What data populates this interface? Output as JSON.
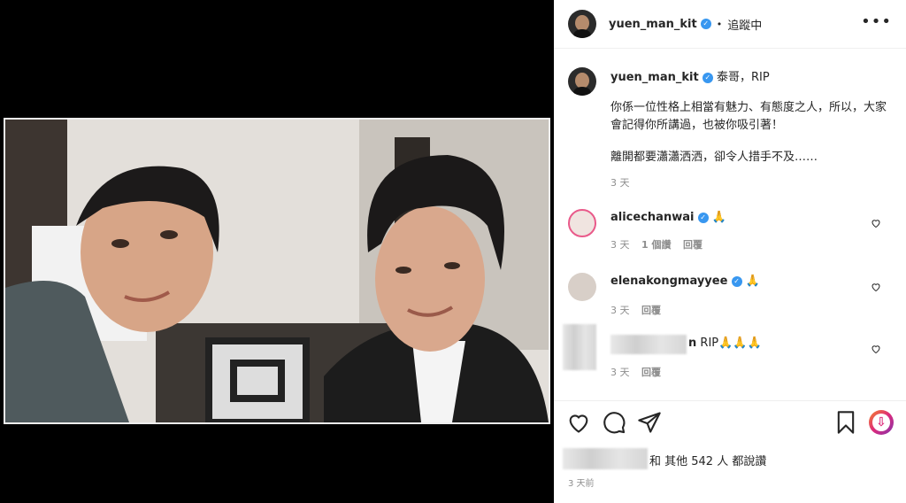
{
  "post": {
    "username": "yuen_man_kit",
    "follow_status": "追蹤中",
    "header_separator": "•",
    "caption_title": "泰哥，RIP",
    "caption_body_1": "你係一位性格上相當有魅力、有態度之人，所以，大家會記得你所講過，也被你吸引著！",
    "caption_body_2": "離開都要瀟瀟洒洒，卻令人措手不及……",
    "caption_time": "3 天"
  },
  "comments": [
    {
      "username": "alicechanwai",
      "text": "🙏",
      "time": "3 天",
      "likes": "1 個讚",
      "reply": "回覆"
    },
    {
      "username": "elenakongmayyee",
      "text": "🙏",
      "time": "3 天",
      "reply": "回覆"
    },
    {
      "username_suffix": "n",
      "text": "RIP🙏🙏🙏",
      "time": "3 天",
      "reply": "回覆"
    }
  ],
  "likes_text": "和 其他 542 人 都說讚",
  "post_time": "3 天前",
  "icons": {
    "more": "more-horizontal-icon",
    "like": "heart-icon",
    "comment": "comment-icon",
    "share": "send-icon",
    "save": "bookmark-icon",
    "extension": "download-icon"
  },
  "colors": {
    "verified": "#3897f0",
    "muted": "#8e8e8e",
    "extension": "#e1306c"
  }
}
